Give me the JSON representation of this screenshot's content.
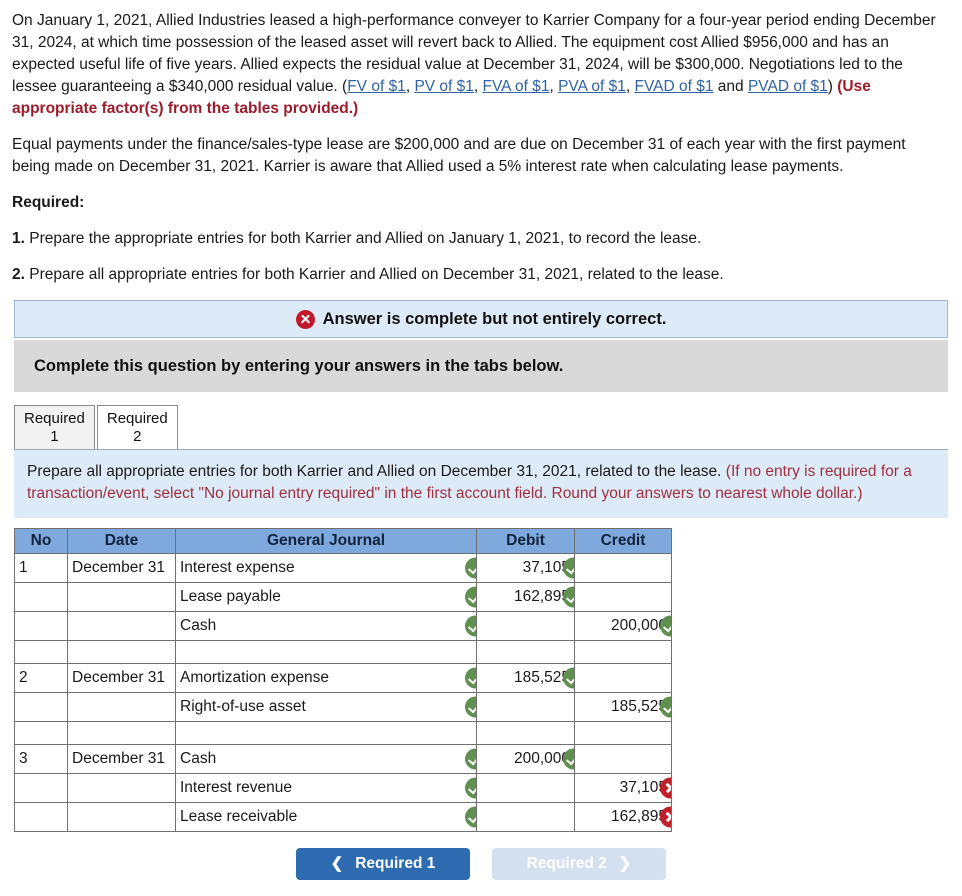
{
  "problem": {
    "paragraph1_part1": "On January 1, 2021, Allied Industries leased a high-performance conveyer to Karrier Company for a four-year period ending December 31, 2024, at which time possession of the leased asset will revert back to Allied. The equipment cost Allied $956,000 and has an expected useful life of five years. Allied expects the residual value at December 31, 2024, will be $300,000. Negotiations led to the lessee guaranteeing a $340,000 residual value. (",
    "links": [
      "FV of $1",
      "PV of $1",
      "FVA of $1",
      "PVA of $1",
      "FVAD of $1",
      "PVAD of $1"
    ],
    "link_sep1": ", ",
    "link_sep2": " and ",
    "paragraph1_part2": ") ",
    "paragraph1_bold_red": "(Use appropriate factor(s) from the tables provided.)",
    "paragraph2": "Equal payments under the finance/sales-type lease are $200,000 and are due on December 31 of each year with the first payment being made on December 31, 2021. Karrier is aware that Allied used a 5% interest rate when calculating lease payments.",
    "required_heading": "Required:",
    "required_items": [
      {
        "num": "1.",
        "text": " Prepare the appropriate entries for both Karrier and Allied on January 1, 2021, to record the lease."
      },
      {
        "num": "2.",
        "text": " Prepare all appropriate entries for both Karrier and Allied on December 31, 2021, related to the lease."
      }
    ]
  },
  "banner": {
    "icon": "error-x-icon",
    "text": "Answer is complete but not entirely correct."
  },
  "grey_bar": {
    "text": "Complete this question by entering your answers in the tabs below."
  },
  "tabs": [
    {
      "label": "Required\n1",
      "active": false
    },
    {
      "label": "Required\n2",
      "active": true
    }
  ],
  "instruction": {
    "main": "Prepare all appropriate entries for both Karrier and Allied on December 31, 2021, related to the lease. ",
    "note": "(If no entry is required for a transaction/event, select \"No journal entry required\" in the first account field. Round your answers to nearest whole dollar.)"
  },
  "journal": {
    "headers": [
      "No",
      "Date",
      "General Journal",
      "Debit",
      "Credit"
    ],
    "rows": [
      {
        "no": "1",
        "date": "December 31",
        "account": "Interest expense",
        "indent": 0,
        "debit": "37,105",
        "credit": "",
        "acct_mark": "ok",
        "amt_mark": "ok",
        "amt_col": "debit",
        "amt_error": false
      },
      {
        "no": "",
        "date": "",
        "account": "Lease payable",
        "indent": 0,
        "debit": "162,895",
        "credit": "",
        "acct_mark": "ok",
        "amt_mark": "ok",
        "amt_col": "debit",
        "amt_error": false
      },
      {
        "no": "",
        "date": "",
        "account": "Cash",
        "indent": 1,
        "debit": "",
        "credit": "200,000",
        "acct_mark": "ok",
        "amt_mark": "ok",
        "amt_col": "credit",
        "amt_error": false
      },
      {
        "spacer": true
      },
      {
        "no": "2",
        "date": "December 31",
        "account": "Amortization expense",
        "indent": 0,
        "debit": "185,525",
        "credit": "",
        "acct_mark": "ok",
        "amt_mark": "ok",
        "amt_col": "debit",
        "amt_error": false
      },
      {
        "no": "",
        "date": "",
        "account": "Right-of-use asset",
        "indent": 1,
        "debit": "",
        "credit": "185,525",
        "acct_mark": "ok",
        "amt_mark": "ok",
        "amt_col": "credit",
        "amt_error": false
      },
      {
        "spacer": true
      },
      {
        "no": "3",
        "date": "December 31",
        "account": "Cash",
        "indent": 0,
        "debit": "200,000",
        "credit": "",
        "acct_mark": "ok",
        "amt_mark": "ok",
        "amt_col": "debit",
        "amt_error": false
      },
      {
        "no": "",
        "date": "",
        "account": "Interest revenue",
        "indent": 1,
        "debit": "",
        "credit": "37,105",
        "acct_mark": "ok",
        "amt_mark": "bad",
        "amt_col": "credit",
        "amt_error": true
      },
      {
        "no": "",
        "date": "",
        "account": "Lease receivable",
        "indent": 1,
        "debit": "",
        "credit": "162,895",
        "acct_mark": "ok",
        "amt_mark": "bad",
        "amt_col": "credit",
        "amt_error": true
      }
    ]
  },
  "footer": {
    "prev_label": "Required 1",
    "next_label": "Required 2",
    "prev_icon": "chevron-left-icon",
    "next_icon": "chevron-right-icon"
  },
  "colors": {
    "header_blue": "#7fa9dd",
    "banner_blue": "#dcebf7",
    "grey_bar": "#d9d9d9",
    "link_blue": "#2f63a5",
    "note_red": "#a03040",
    "ok_green": "#5f9050",
    "bad_red": "#c0202a",
    "btn_blue": "#2f6bb0",
    "btn_disabled": "#d3e0ef"
  }
}
